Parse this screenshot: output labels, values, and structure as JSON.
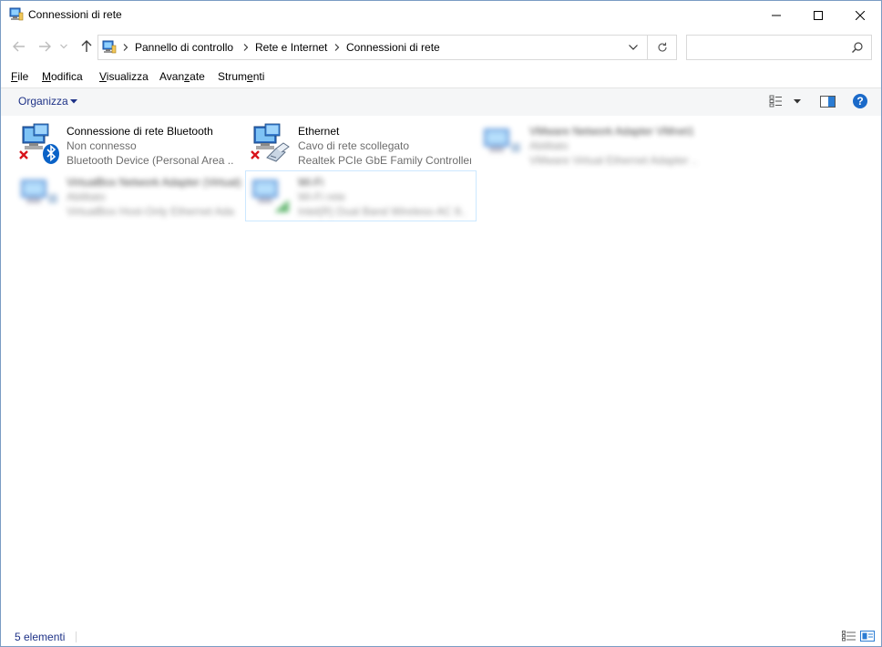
{
  "window": {
    "title": "Connessioni di rete"
  },
  "address": {
    "crumbs": [
      "Pannello di controllo",
      "Rete e Internet",
      "Connessioni di rete"
    ],
    "search_placeholder": ""
  },
  "menu": {
    "file": {
      "key": "F",
      "rest": "ile"
    },
    "modifica": {
      "key": "M",
      "rest": "odifica"
    },
    "visualizza": {
      "key": "V",
      "rest": "isualizza"
    },
    "avanzate": {
      "pre": "Avan",
      "key": "z",
      "rest": "ate"
    },
    "strumenti": {
      "pre": "Strum",
      "key": "e",
      "rest": "nti"
    }
  },
  "toolbar": {
    "organize_label": "Organizza",
    "help_label": "?"
  },
  "connections": [
    {
      "name": "Connessione di rete Bluetooth",
      "status": "Non connesso",
      "device": "Bluetooth Device (Personal Area ...",
      "icon": "network-bluetooth-icon",
      "error_badge": true
    },
    {
      "name": "Ethernet",
      "status": "Cavo di rete scollegato",
      "device": "Realtek PCIe GbE Family Controller",
      "icon": "network-ethernet-icon",
      "error_badge": true
    },
    {
      "name": "VMware Network Adapter VMnet1",
      "status": "Abilitato",
      "device": "VMware Virtual Ethernet Adapter ...",
      "icon": "network-adapter-icon",
      "blurred": true
    },
    {
      "name": "VirtualBox Network Adapter (Virtual)",
      "status": "Abilitato",
      "device": "VirtualBox Host-Only Ethernet Adapter",
      "icon": "network-adapter-icon",
      "blurred": true
    },
    {
      "name": "Wi-Fi",
      "status": "Wi-Fi rete",
      "device": "Intel(R) Dual Band Wireless-AC 8...",
      "icon": "network-wifi-icon",
      "blurred": true,
      "selected": true
    }
  ],
  "statusbar": {
    "count": "5 elementi"
  },
  "colors": {
    "accent": "#1e3287",
    "help": "#1b6ac9",
    "selection": "#cce8ff",
    "error_red": "#d8141b",
    "bluetooth_blue": "#0a62c7"
  }
}
